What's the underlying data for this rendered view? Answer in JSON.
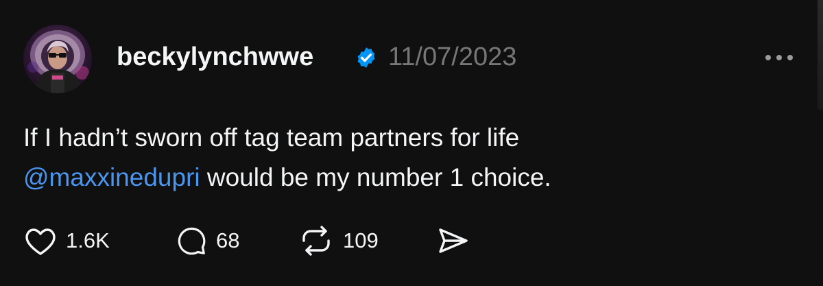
{
  "post": {
    "username": "beckylynchwwe",
    "verified": true,
    "timestamp": "11/07/2023",
    "body": {
      "line1": "If I hadn’t sworn off tag team partners for life",
      "mention": "@maxxinedupri",
      "line2_rest": " would be my number 1 choice."
    },
    "actions": {
      "likes": "1.6K",
      "replies": "68",
      "reposts": "109"
    }
  },
  "colors": {
    "background": "#101010",
    "text": "#f3f5f7",
    "muted": "#777777",
    "link": "#4a95f0",
    "verified": "#0095f6"
  },
  "icons": {
    "more": "more-horizontal-icon",
    "verified": "verified-badge-icon",
    "like": "heart-icon",
    "reply": "comment-bubble-icon",
    "repost": "repost-arrows-icon",
    "share": "send-arrow-icon"
  }
}
